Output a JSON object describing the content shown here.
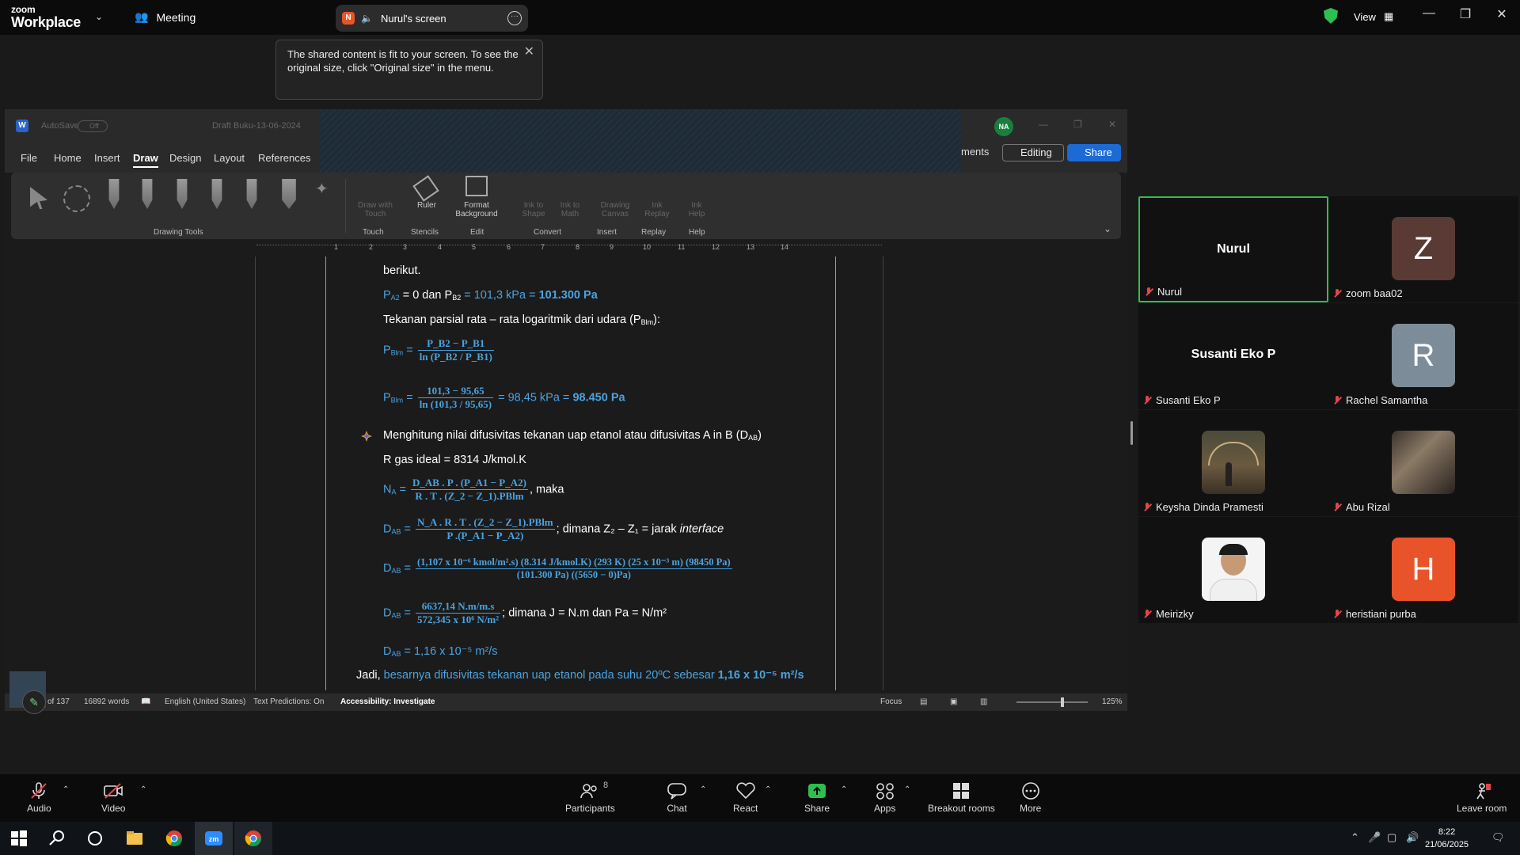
{
  "zoom": {
    "brand_top": "zoom",
    "brand_bottom": "Workplace",
    "meeting_label": "Meeting",
    "screen_badge": "N",
    "screen_label": "Nurul's screen",
    "view_label": "View",
    "tooltip": "The shared content is fit to your screen. To see the original size, click \"Original size\" in the menu."
  },
  "word": {
    "autosave": "AutoSave",
    "toggle": "Off",
    "docname": "Draft Buku-13-06-2024",
    "user_initials": "NA",
    "menu": [
      "File",
      "Home",
      "Insert",
      "Draw",
      "Design",
      "Layout",
      "References"
    ],
    "active_menu": "Draw",
    "comments_label": "ments",
    "editing_label": "Editing",
    "share_label": "Share",
    "ribbon": {
      "drawing_tools": "Drawing Tools",
      "draw_with_touch": "Draw with Touch",
      "touch": "Touch",
      "ruler": "Ruler",
      "stencils": "Stencils",
      "format_background": "Format Background",
      "edit": "Edit",
      "ink_to_shape": "Ink to Shape",
      "ink_to_math": "Ink to Math",
      "convert": "Convert",
      "drawing_canvas": "Drawing Canvas",
      "insert": "Insert",
      "ink_replay": "Ink Replay",
      "replay": "Replay",
      "ink_help": "Ink Help",
      "help": "Help"
    },
    "ruler_numbers": [
      "1",
      "2",
      "3",
      "4",
      "5",
      "6",
      "7",
      "8",
      "9",
      "10",
      "11",
      "12",
      "13",
      "14"
    ],
    "status": {
      "pages": "of 137",
      "words": "16892 words",
      "language": "English (United States)",
      "predictions": "Text Predictions: On",
      "accessibility": "Accessibility: Investigate",
      "focus": "Focus",
      "zoom": "125%"
    }
  },
  "doc": {
    "l1": "berikut.",
    "l2_a": "P",
    "l2_a_sub": "A2",
    "l2_b": " = 0 dan P",
    "l2_b_sub": "B2",
    "l2_c": " = 101,3 kPa = ",
    "l2_bold": "101.300 Pa",
    "l3": "Tekanan parsial rata – rata logaritmik dari udara (P",
    "l3_sub": "Blm",
    "l3_end": "):",
    "f1_lhs": "P",
    "f1_lhs_sub": "Blm",
    "f1_num": "P_B2 − P_B1",
    "f1_den": "ln (P_B2 / P_B1)",
    "f2_num": "101,3 − 95,65",
    "f2_den": "ln (101,3 / 95,65)",
    "f2_mid": " = 98,45 kPa = ",
    "f2_bold": "98.450 Pa",
    "bullet": "Menghitung nilai difusivitas tekanan uap etanol atau difusivitas A in B (D",
    "bullet_sub": "AB",
    "bullet_end": ")",
    "rgas": "R gas ideal = 8314 J/kmol.K",
    "na_lhs": "N",
    "na_lhs_sub": "A",
    "na_num": "D_AB . P . (P_A1 − P_A2)",
    "na_den": "R . T . (Z_2 − Z_1).PBlm",
    "na_end": ", maka",
    "dab_lhs": "D",
    "dab_lhs_sub": "AB",
    "dab1_num": "N_A . R . T . (Z_2 − Z_1).PBlm",
    "dab1_den": "P .(P_A1 − P_A2)",
    "dab1_end": "; dimana Z₂ – Z₁ = jarak ",
    "dab1_italic": "interface",
    "dab2_num": "(1,107 x 10⁻⁶ kmol/m².s) (8.314 J/kmol.K) (293 K) (25 x 10⁻³ m) (98450 Pa)",
    "dab2_den": "(101.300 Pa) ((5650 − 0)Pa)",
    "dab3_num": "6637,14 N.m/m.s",
    "dab3_den": "572,345 x 10⁶ N/m²",
    "dab3_end": ";   dimana J = N.m dan Pa = N/m²",
    "dab4": " = 1,16 x 10⁻⁵ m²/s",
    "final_a": "Jadi, ",
    "final_b": "besarnya difusivitas tekanan uap etanol pada suhu 20ºC sebesar ",
    "final_bold": "1,16 x 10⁻⁵ m²/s"
  },
  "participants": [
    {
      "name": "Nurul",
      "display": "Nurul",
      "kind": "name",
      "active": true
    },
    {
      "name": "zoom baa02",
      "display": "Z",
      "kind": "avatar",
      "color": "#5a3a34"
    },
    {
      "name": "Susanti Eko P",
      "display": "Susanti Eko P",
      "kind": "name"
    },
    {
      "name": "Rachel Samantha",
      "display": "R",
      "kind": "avatar",
      "color": "#7c8d99"
    },
    {
      "name": "Keysha Dinda Pramesti",
      "kind": "photo"
    },
    {
      "name": "Abu Rizal",
      "kind": "photo"
    },
    {
      "name": "Meirizky",
      "kind": "photo"
    },
    {
      "name": "heristiani purba",
      "display": "H",
      "kind": "avatar",
      "color": "#e8532a"
    }
  ],
  "toolbar": {
    "audio": "Audio",
    "video": "Video",
    "participants": "Participants",
    "participants_count": "8",
    "chat": "Chat",
    "react": "React",
    "share": "Share",
    "apps": "Apps",
    "breakout": "Breakout rooms",
    "more": "More",
    "leave": "Leave room"
  },
  "taskbar": {
    "time": "8:22",
    "date": "21/06/2025"
  },
  "colors": {
    "accent_green": "#2fbf4f",
    "doc_blue": "#4aa3df",
    "word_blue": "#1b6ad6",
    "mute_red": "#e0474c"
  }
}
